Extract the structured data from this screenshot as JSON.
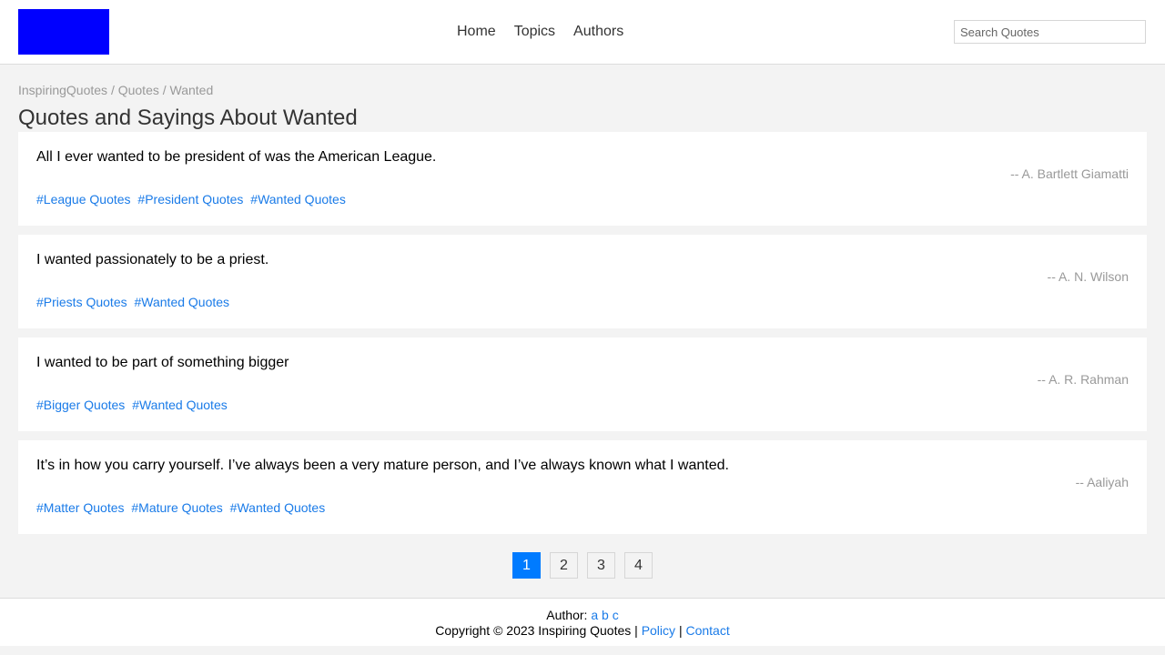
{
  "header": {
    "nav": [
      "Home",
      "Topics",
      "Authors"
    ],
    "search_placeholder": "Search Quotes"
  },
  "breadcrumb": "InspiringQuotes / Quotes / Wanted",
  "page_title": "Quotes and Sayings About Wanted",
  "quotes": [
    {
      "text": "All I ever wanted to be president of was the American League.",
      "author": "-- A. Bartlett Giamatti",
      "tags": [
        "#League Quotes",
        "#President Quotes",
        "#Wanted Quotes"
      ]
    },
    {
      "text": "I wanted passionately to be a priest.",
      "author": "-- A. N. Wilson",
      "tags": [
        "#Priests Quotes",
        "#Wanted Quotes"
      ]
    },
    {
      "text": "I wanted to be part of something bigger",
      "author": "-- A. R. Rahman",
      "tags": [
        "#Bigger Quotes",
        "#Wanted Quotes"
      ]
    },
    {
      "text": "It’s in how you carry yourself. I’ve always been a very mature person, and I’ve always known what I wanted.",
      "author": "-- Aaliyah",
      "tags": [
        "#Matter Quotes",
        "#Mature Quotes",
        "#Wanted Quotes"
      ]
    }
  ],
  "pagination": {
    "pages": [
      "1",
      "2",
      "3",
      "4"
    ],
    "current": "1"
  },
  "footer": {
    "author_label": "Author:",
    "author_links": [
      "a",
      "b",
      "c"
    ],
    "copyright": "Copyright © 2023 Inspiring Quotes |",
    "policy": "Policy",
    "separator": "|",
    "contact": "Contact"
  },
  "colors": {
    "accent": "#007bff",
    "logo": "#0000ff",
    "link": "#1a7be8"
  }
}
